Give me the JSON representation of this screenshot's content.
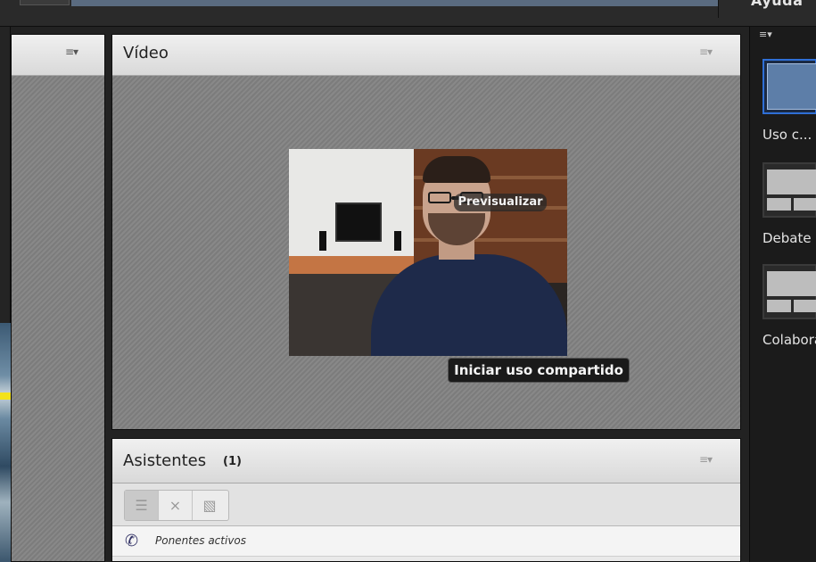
{
  "menubar": {
    "help_menu": "Ayuda"
  },
  "left_pod": {
    "menu_icon": "list-menu-icon"
  },
  "video_pod": {
    "title": "Vídeo",
    "preview_label": "Previsualizar",
    "share_button": "Iniciar uso compartido"
  },
  "attendees_pod": {
    "title": "Asistentes",
    "count": "(1)",
    "toolbar": [
      "list-view-icon",
      "grid-view-icon",
      "attendee-details-icon"
    ],
    "speakers_label": "Ponentes activos"
  },
  "layouts": [
    {
      "label": "Uso c...",
      "selected": true
    },
    {
      "label": "Debate",
      "selected": false
    },
    {
      "label": "Colaboración",
      "selected": false
    }
  ],
  "colors": {
    "selection_border": "#2f6fd6",
    "pod_header": "#e4e4e4"
  }
}
